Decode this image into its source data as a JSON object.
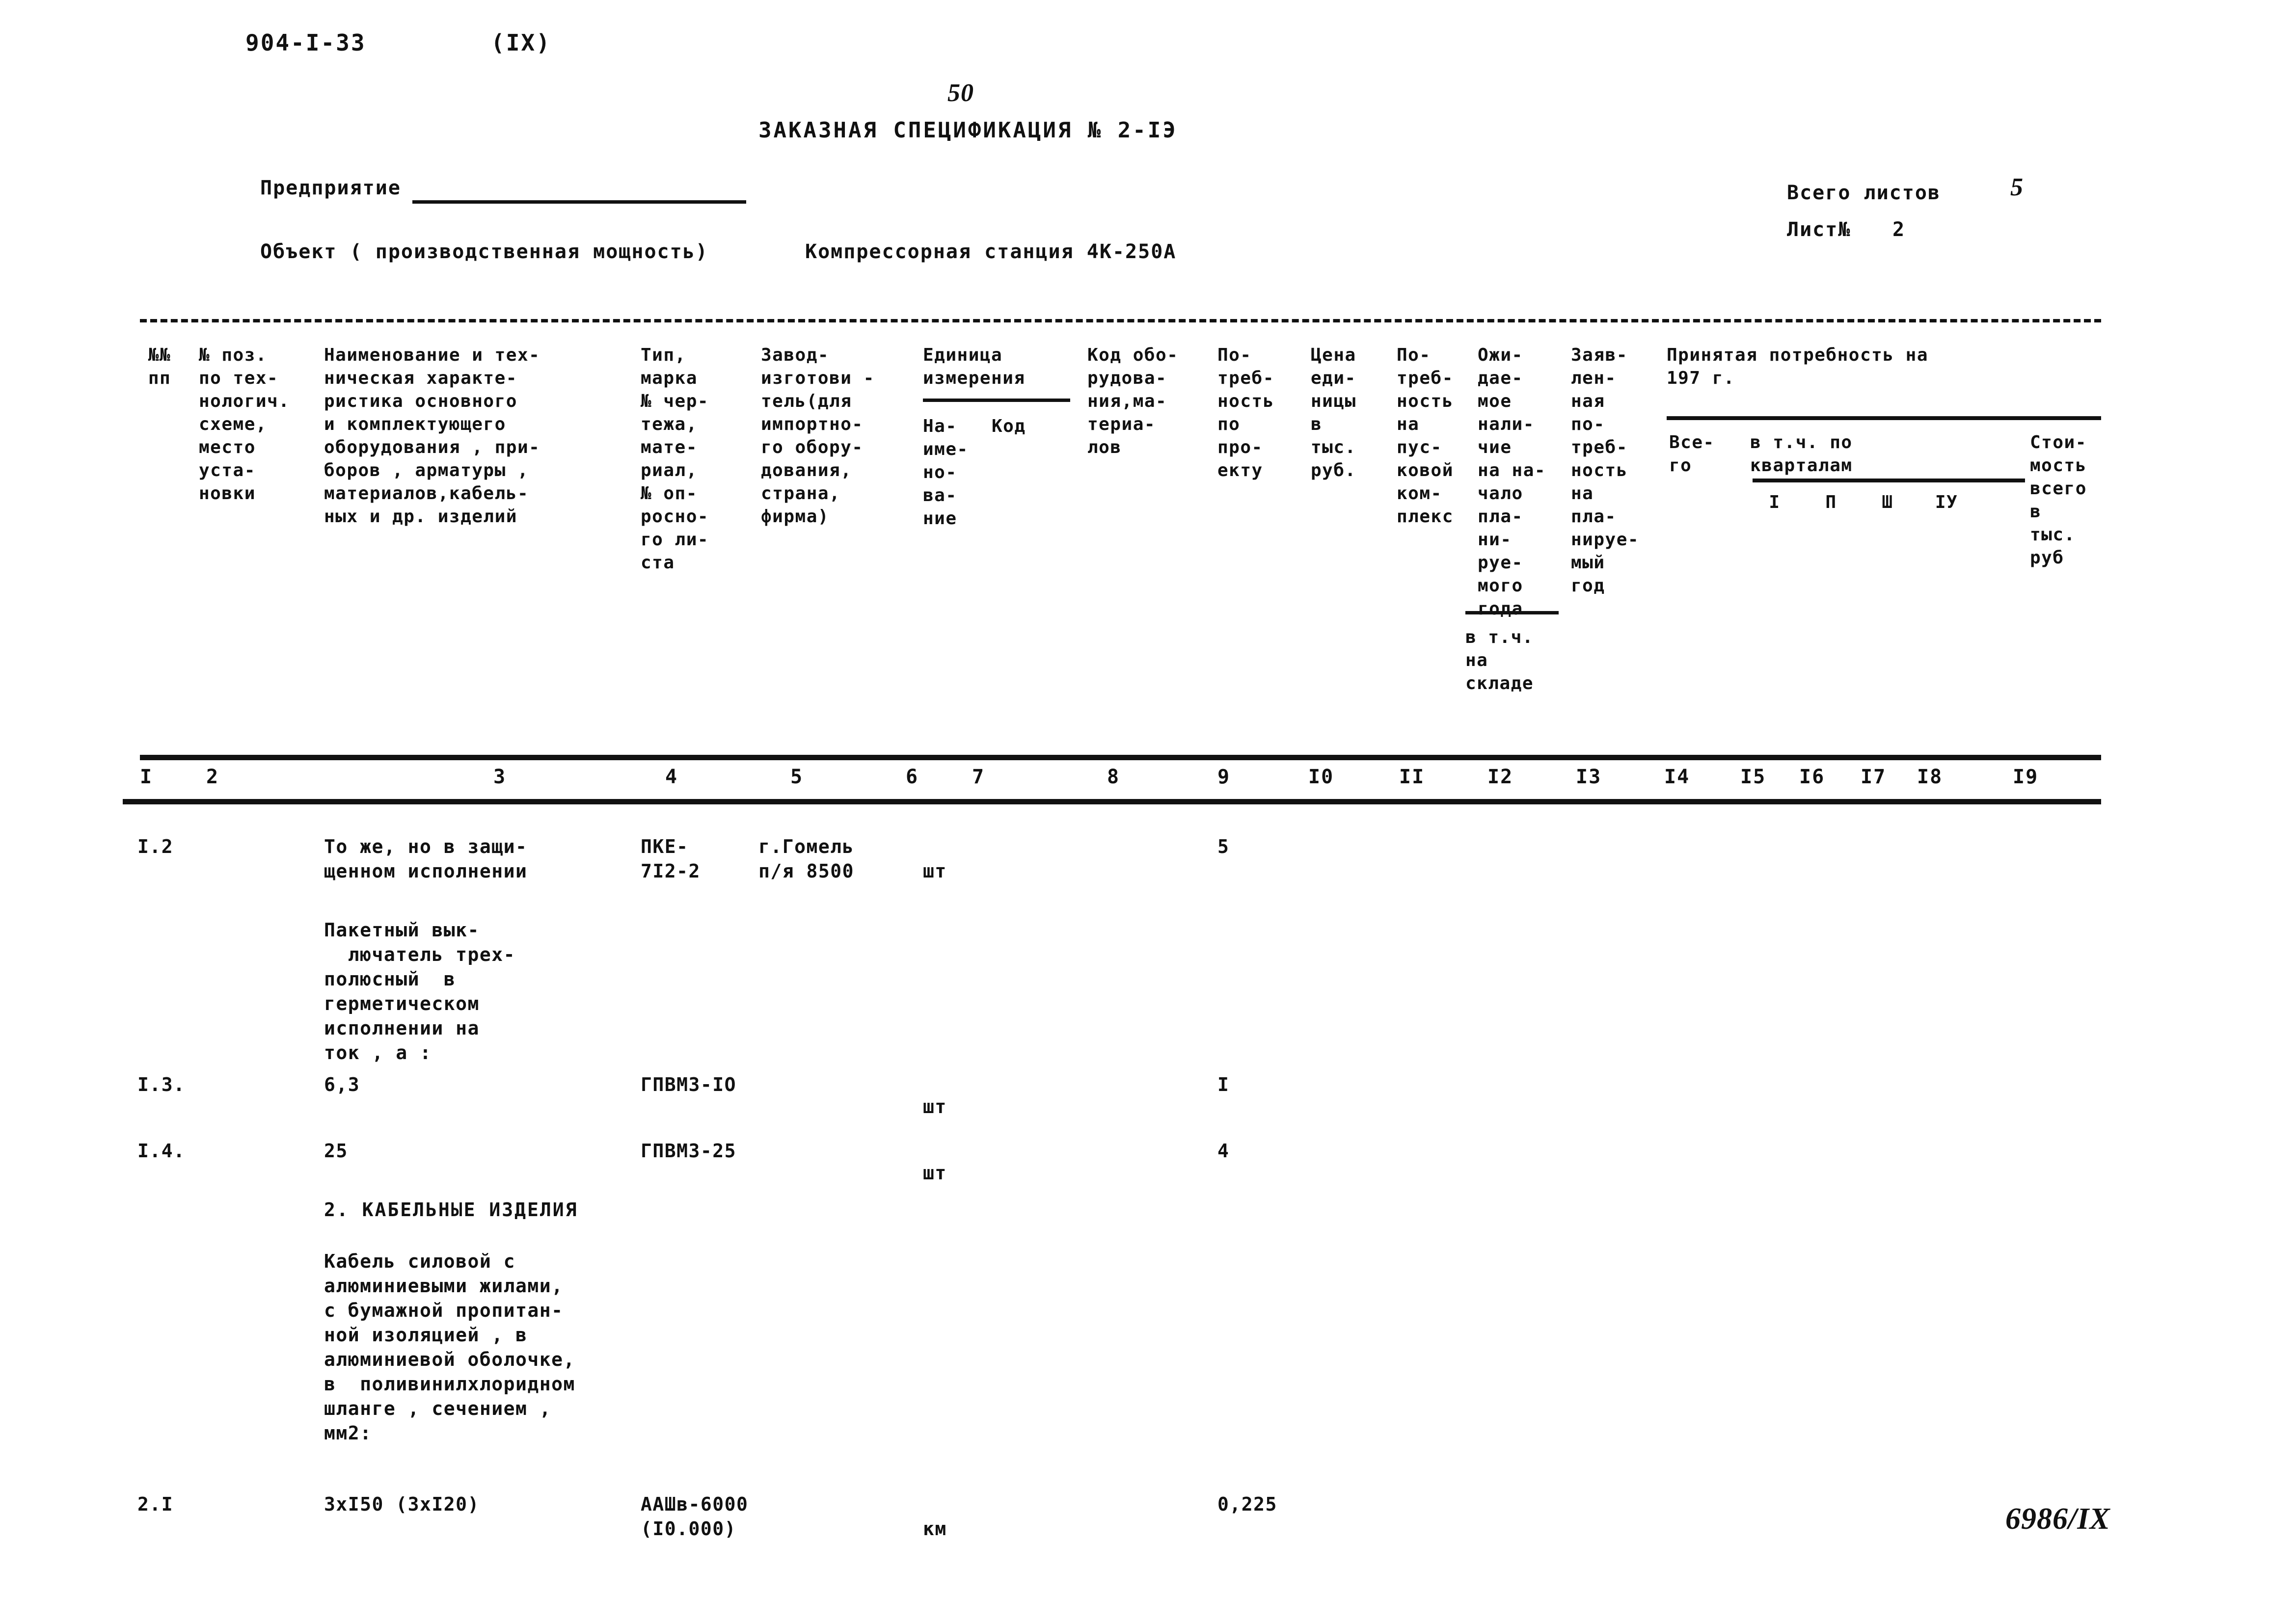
{
  "document": {
    "code": "904-I-33",
    "section": "(IX)",
    "page_handwritten": "50",
    "title": "ЗАКАЗНАЯ СПЕЦИФИКАЦИЯ № 2-IЭ",
    "enterprise_label": "Предприятие",
    "enterprise_value": "",
    "object_label": "Объект ( производственная мощность)",
    "object_value": "Компрессорная станция 4К-250А",
    "total_sheets_label": "Всего листов",
    "total_sheets_value": "5",
    "sheet_label": "Лист№",
    "sheet_value": "2",
    "stamp_handwritten": "6986/IX"
  },
  "table": {
    "headers": {
      "col1": "№№\nпп",
      "col2": "№ поз.\nпо тех-\nнологич.\nсхеме,\nместо\nуста-\nновки",
      "col3": "Наименование и тех-\nническая характе-\nристика основного\nи комплектующего\nоборудования , при-\nборов , арматуры ,\nматериалов,кабель-\nных  и др. изделий",
      "col4": "Тип,\nмарка\n№ чер-\nтежа,\nмате-\nриал,\n№ оп-\nросно-\nго ли-\nста",
      "col5": "Завод-\nизготови -\nтель(для\nимпортно-\nго обору-\nдования,\nстрана,\nфирма)",
      "col6_group": "Единица\nизмерения",
      "col6": "На-\nиме-\nно-\nва-\nние",
      "col7": "Код",
      "col8": "Код обо-\nрудова-\nния,ма-\nтериа-\nлов",
      "col9": "По-\nтреб-\nность\nпо\nпро-\nекту",
      "col10": "Цена\nеди-\nницы\nв\nтыс.\nруб.",
      "col11": "По-\nтреб-\nность\nна\nпус-\nковой\nком-\nплекс",
      "col12": "Ожи-\nдае-\nмое\nнали-\nчие\nна на-\nчало\nпла-\nни-\nруе-\nмого\nгода",
      "col12_note": "в т.ч.\nна\nскладе",
      "col13": "Заяв-\nлен-\nная\nпо-\nтреб-\nность\nна\nпла-\nнируе-\nмый\nгод",
      "right_group": "Принятая потребность на\n197        г.",
      "col14": "Все-\nго",
      "quarters_group": "в т.ч. по\nкварталам",
      "q1": "I",
      "q2": "П",
      "q3": "Ш",
      "q4": "IУ",
      "col19": "Стои-\nмость\nвсего\nв\nтыс.\nруб"
    },
    "column_numbers": [
      "I",
      "2",
      "3",
      "4",
      "5",
      "6",
      "7",
      "8",
      "9",
      "I0",
      "II",
      "I2",
      "I3",
      "I4",
      "I5",
      "I6",
      "I7",
      "I8",
      "I9"
    ],
    "rows": [
      {
        "kind": "item",
        "no": "I.2",
        "name": "То же, но в защи-\nщенном исполнении",
        "type": "ПКЕ-\n7I2-2",
        "maker": "г.Гомель\nп/я 8500",
        "unit": "шт",
        "qty": "5"
      },
      {
        "kind": "description",
        "name": "Пакетный вык-\n  лючатель трех-\nполюсный  в\nгерметическом\nисполнении на\nток , а :"
      },
      {
        "kind": "item",
        "no": "I.3.",
        "name": "6,3",
        "type": "ГПВМ3-IO",
        "maker": "",
        "unit": "шт",
        "qty": "I"
      },
      {
        "kind": "item",
        "no": "I.4.",
        "name": "25",
        "type": "ГПВМ3-25",
        "maker": "",
        "unit": "шт",
        "qty": "4"
      },
      {
        "kind": "section",
        "name": "2. КАБЕЛЬНЫЕ ИЗДЕЛИЯ"
      },
      {
        "kind": "description",
        "name": "Кабель силовой с\nалюминиевыми жилами,\nс бумажной пропитан-\nной изоляцией , в\nалюминиевой оболочке,\nв  поливинилхлоридном\nшланге , сечением ,\nмм2:"
      },
      {
        "kind": "item",
        "no": "2.I",
        "name": "3хI50 (3хI20)",
        "type": "ААШв-6000\n(I0.000)",
        "maker": "",
        "unit": "км",
        "qty": "0,225"
      }
    ]
  }
}
